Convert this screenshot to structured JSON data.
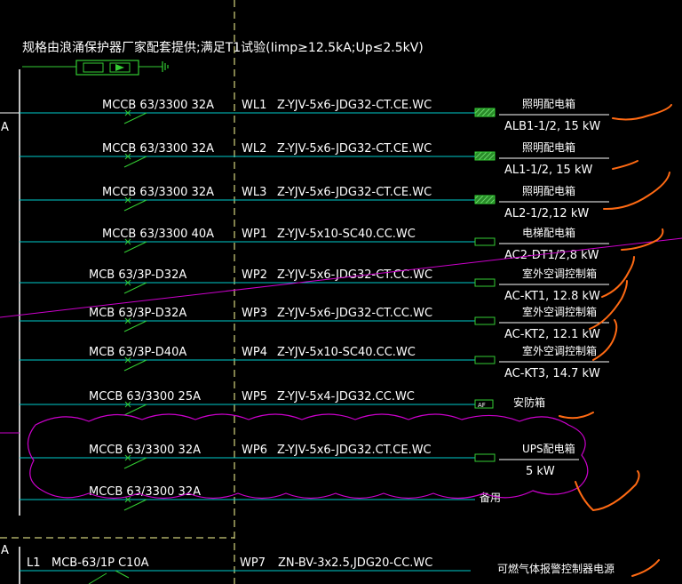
{
  "header_note": "规格由浪涌保护器厂家配套提供;满足T1试验(Iimp≥12.5kA;Up≤2.5kV)",
  "bus_label": "A",
  "bus_label_lower": "A",
  "colors": {
    "background": "#000000",
    "text": "#ffffff",
    "circuit_line": "#00cccc",
    "breaker_green": "#33cc33",
    "revision_cloud": "#cc00cc",
    "markup_orange": "#ff6a13",
    "divider_dashed": "#ffff99"
  },
  "circuits": [
    {
      "breaker": "MCCB 63/3300  32A",
      "code": "WL1",
      "cable": "Z-YJV-5x6-JDG32-CT.CE.WC",
      "load": "照明配电箱",
      "detail": "ALB1-1/2, 15 kW",
      "terminal": "hatched"
    },
    {
      "breaker": "MCCB 63/3300  32A",
      "code": "WL2",
      "cable": "Z-YJV-5x6-JDG32-CT.CE.WC",
      "load": "照明配电箱",
      "detail": "AL1-1/2, 15 kW",
      "terminal": "hatched"
    },
    {
      "breaker": "MCCB 63/3300  32A",
      "code": "WL3",
      "cable": "Z-YJV-5x6-JDG32-CT.CE.WC",
      "load": "照明配电箱",
      "detail": "AL2-1/2,12 kW",
      "terminal": "hatched"
    },
    {
      "breaker": "MCCB 63/3300  40A",
      "code": "WP1",
      "cable": "Z-YJV-5x10-SC40.CC.WC",
      "load": "电梯配电箱",
      "detail": "AC2-DT1/2,8 kW",
      "terminal": "box"
    },
    {
      "breaker": "MCB 63/3P-D32A",
      "code": "WP2",
      "cable": "Z-YJV-5x6-JDG32-CT.CC.WC",
      "load": "室外空调控制箱",
      "detail": "AC-KT1,  12.8 kW",
      "terminal": "box"
    },
    {
      "breaker": "MCB 63/3P-D32A",
      "code": "WP3",
      "cable": "Z-YJV-5x6-JDG32-CT.CC.WC",
      "load": "室外空调控制箱",
      "detail": "AC-KT2,  12.1 kW",
      "terminal": "box"
    },
    {
      "breaker": "MCB 63/3P-D40A",
      "code": "WP4",
      "cable": "Z-YJV-5x10-SC40.CC.WC",
      "load": "室外空调控制箱",
      "detail": "AC-KT3,  14.7 kW",
      "terminal": "box"
    },
    {
      "breaker": "MCCB 63/3300   25A",
      "code": "WP5",
      "cable": "Z-YJV-5x4-JDG32.CC.WC",
      "load": "安防箱",
      "detail": "",
      "terminal": "AF"
    },
    {
      "breaker": "MCCB 63/3300  32A",
      "code": "WP6",
      "cable": "Z-YJV-5x6-JDG32.CT.CE.WC",
      "load": "UPS配电箱",
      "detail": "5 kW",
      "terminal": "box"
    },
    {
      "breaker": "MCCB 63/3300  32A",
      "code": "",
      "cable": "",
      "load": "备用",
      "detail": "",
      "terminal": "none"
    }
  ],
  "bottom_circuit": {
    "phase": "L1",
    "breaker": "MCB-63/1P  C10A",
    "code": "WP7",
    "cable": "ZN-BV-3x2.5,JDG20-CC.WC",
    "load": "可燃气体报警控制器电源"
  }
}
